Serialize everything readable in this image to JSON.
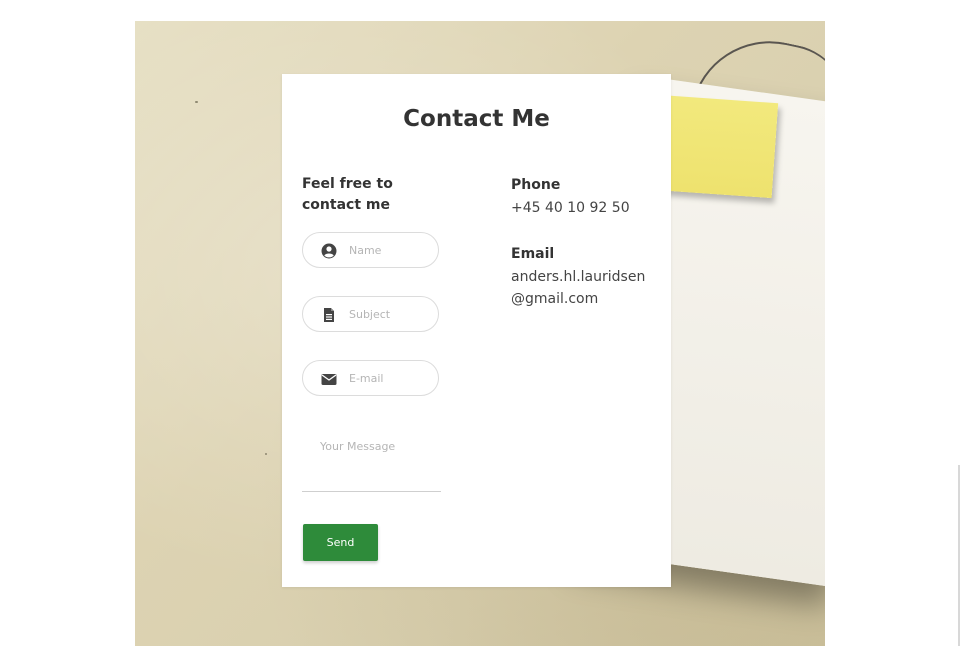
{
  "contact": {
    "title": "Contact Me",
    "subtitle": "Feel free to contact me",
    "form": {
      "name_placeholder": "Name",
      "subject_placeholder": "Subject",
      "email_placeholder": "E-mail",
      "message_placeholder": "Your Message",
      "send_label": "Send"
    },
    "info": {
      "phone_label": "Phone",
      "phone_value": "+45 40 10 92 50",
      "email_label": "Email",
      "email_value": "anders.hl.lauridsen@gmail.com"
    }
  },
  "colors": {
    "send_button": "#2e8b3a",
    "background_paper": "#ddd3b2",
    "sticky_note": "#f2e97d"
  },
  "icons": {
    "name": "user-circle-icon",
    "subject": "file-text-icon",
    "email": "envelope-icon"
  }
}
